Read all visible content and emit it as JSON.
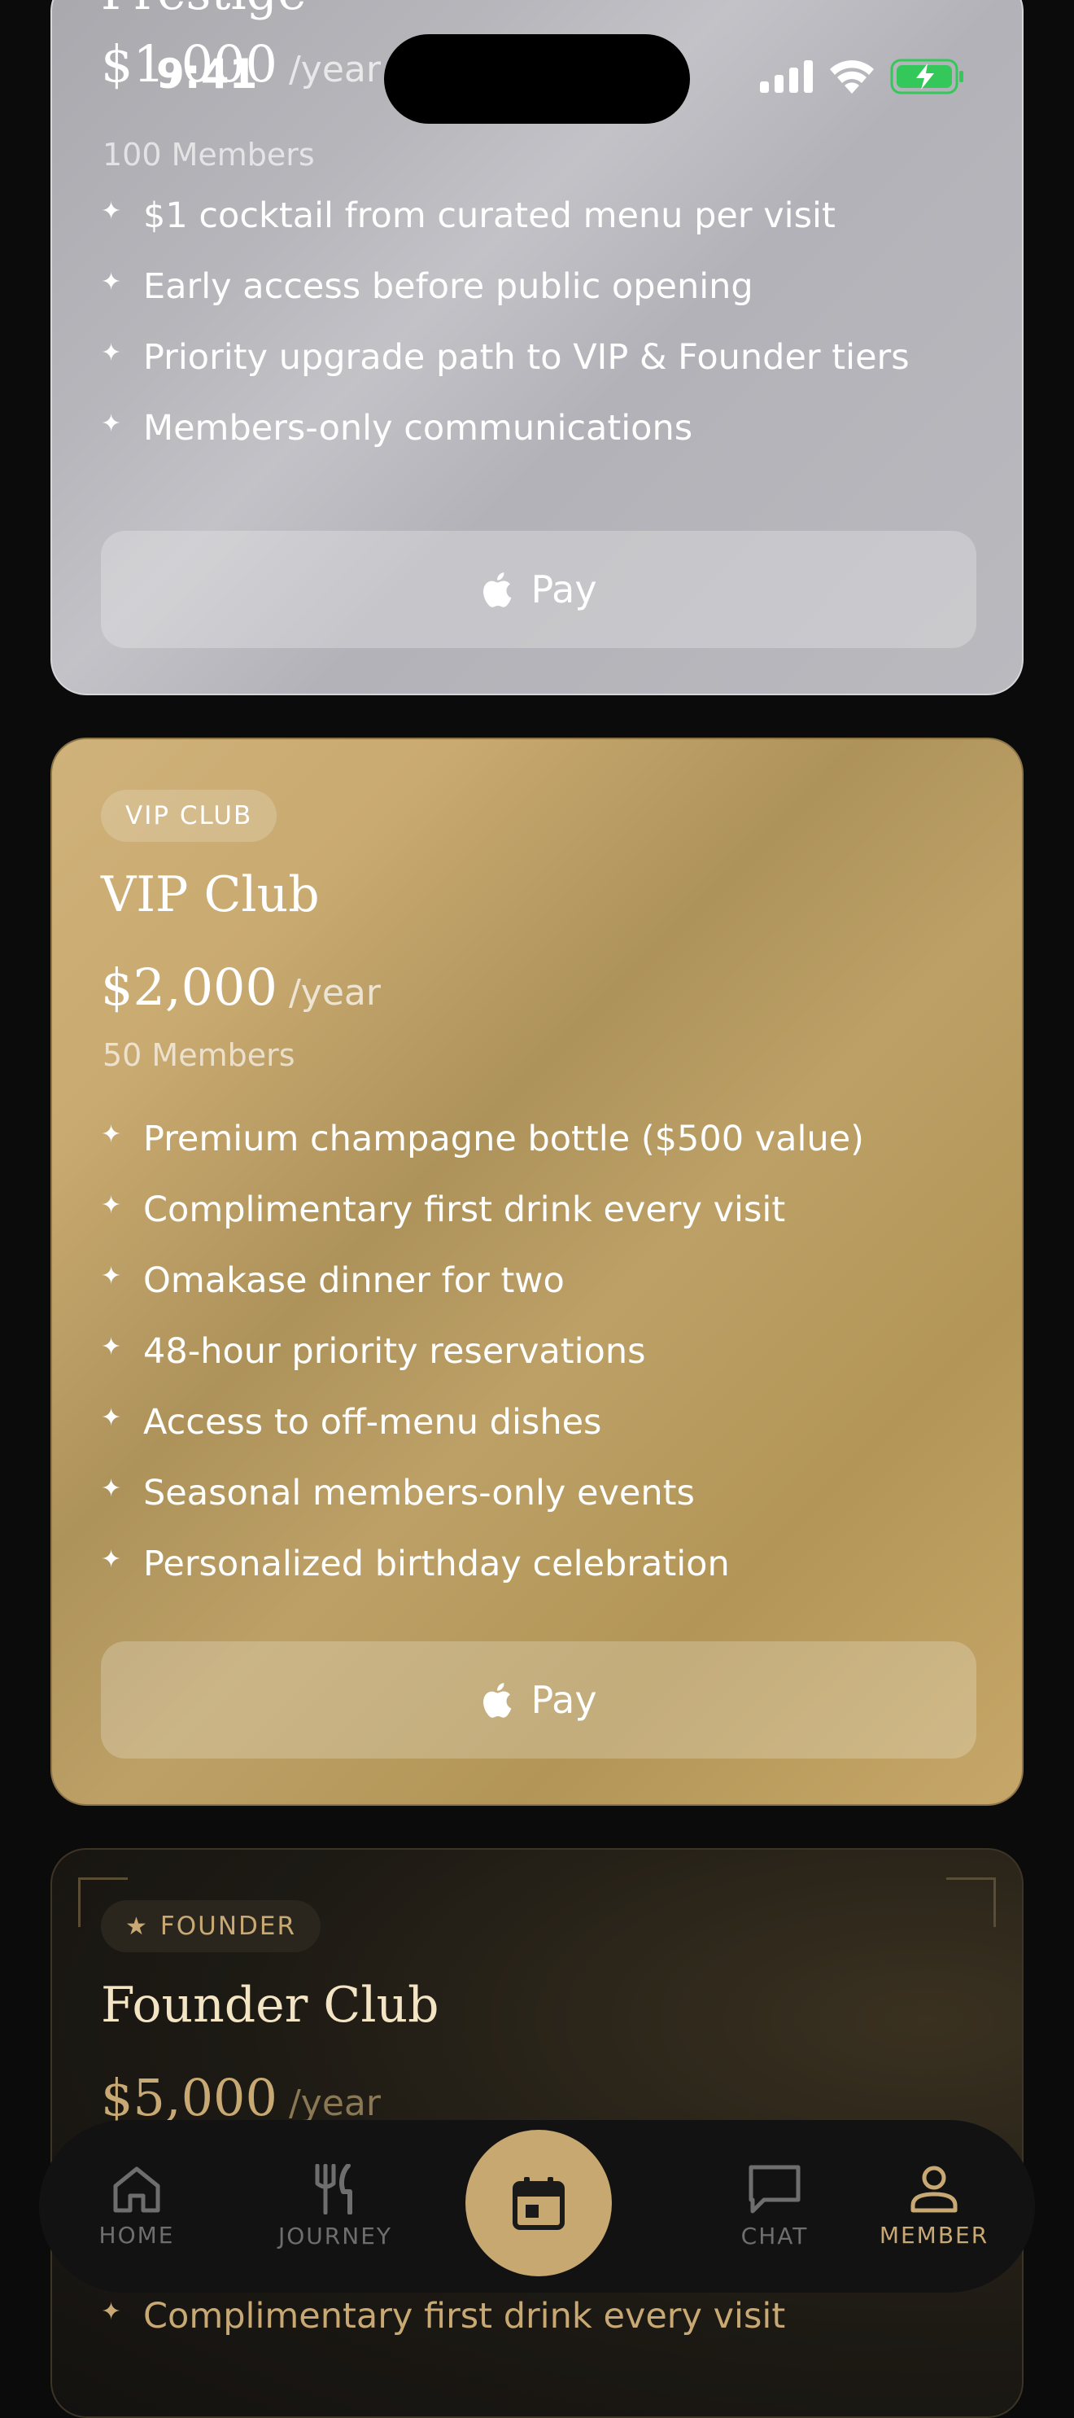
{
  "status": {
    "time": "9:41"
  },
  "prestige": {
    "title": "Prestige",
    "price": "$1,000",
    "period": "/year",
    "members": "100 Members",
    "features": [
      "$1 cocktail from curated menu per visit",
      "Early access before public opening",
      "Priority upgrade path to VIP & Founder tiers",
      "Members-only communications"
    ],
    "pay_label": "Pay"
  },
  "vip": {
    "badge": "VIP CLUB",
    "title": "VIP Club",
    "price": "$2,000",
    "period": "/year",
    "members": "50 Members",
    "features": [
      "Premium champagne bottle ($500 value)",
      "Complimentary first drink every visit",
      "Omakase dinner for two",
      "48-hour priority reservations",
      "Access to off-menu dishes",
      "Seasonal members-only events",
      "Personalized birthday celebration"
    ],
    "pay_label": "Pay"
  },
  "founder": {
    "badge": "FOUNDER",
    "title": "Founder Club",
    "price": "$5,000",
    "period": "/year",
    "features": [
      "Complimentary first drink every visit"
    ]
  },
  "tabbar": {
    "home": "HOME",
    "journey": "JOURNEY",
    "chat": "CHAT",
    "member": "MEMBER"
  },
  "colors": {
    "accent_gold": "#c6a870",
    "battery_green": "#34c759"
  },
  "icons": {
    "feature": "sparkle-icon",
    "pay": "apple-icon",
    "home": "home-icon",
    "journey": "fork-knife-icon",
    "center": "calendar-icon",
    "chat": "chat-bubble-icon",
    "member": "person-icon"
  }
}
